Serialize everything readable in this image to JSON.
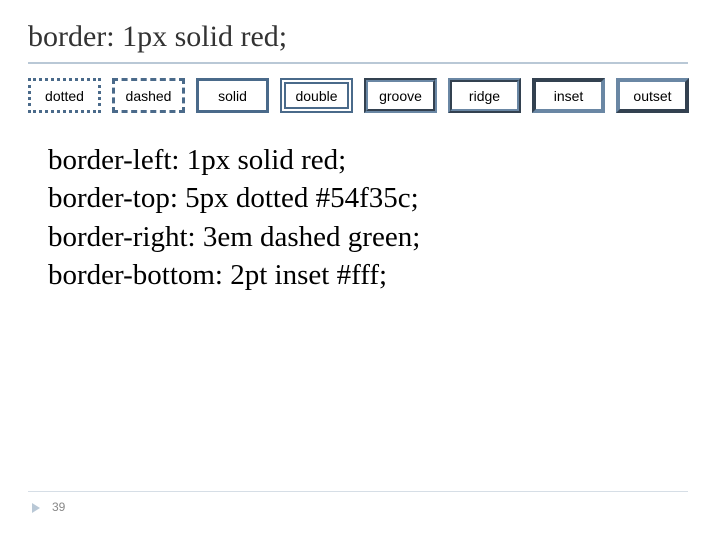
{
  "title": "border: 1px solid red;",
  "swatches": [
    {
      "label": "dotted"
    },
    {
      "label": "dashed"
    },
    {
      "label": "solid"
    },
    {
      "label": "double"
    },
    {
      "label": "groove"
    },
    {
      "label": "ridge"
    },
    {
      "label": "inset"
    },
    {
      "label": "outset"
    }
  ],
  "code": {
    "l1": "border-left: 1px solid red;",
    "l2": "border-top: 5px dotted #54f35c;",
    "l3": "border-right:  3em dashed green;",
    "l4": "border-bottom: 2pt inset #fff;"
  },
  "page_number": "39"
}
